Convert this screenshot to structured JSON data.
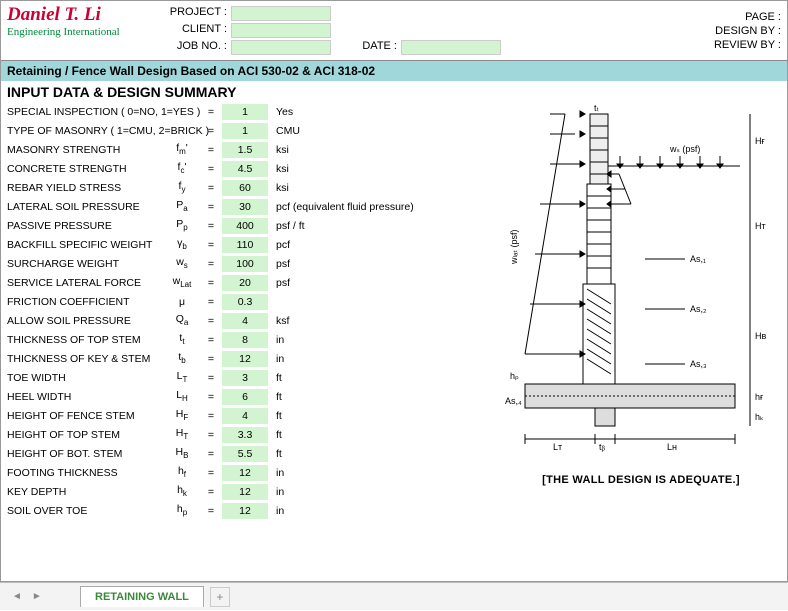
{
  "header": {
    "logo_name": "Daniel T. Li",
    "logo_sub": "Engineering International",
    "project_lbl": "PROJECT :",
    "client_lbl": "CLIENT :",
    "jobno_lbl": "JOB NO. :",
    "date_lbl": "DATE :",
    "page_lbl": "PAGE :",
    "designby_lbl": "DESIGN BY :",
    "reviewby_lbl": "REVIEW BY :"
  },
  "titlebar": "Retaining / Fence Wall Design Based on ACI 530-02 & ACI 318-02",
  "section_title": "INPUT DATA & DESIGN SUMMARY",
  "rows": [
    {
      "desc": "SPECIAL INSPECTION ( 0=NO, 1=YES )",
      "sym": "",
      "val": "1",
      "unit": "Yes"
    },
    {
      "desc": "TYPE OF MASONRY ( 1=CMU, 2=BRICK )",
      "sym": "",
      "val": "1",
      "unit": "CMU"
    },
    {
      "desc": "MASONRY STRENGTH",
      "sym": "f<sub>m</sub>'",
      "val": "1.5",
      "unit": "ksi"
    },
    {
      "desc": "CONCRETE STRENGTH",
      "sym": "f<sub>c</sub>'",
      "val": "4.5",
      "unit": "ksi"
    },
    {
      "desc": "REBAR YIELD STRESS",
      "sym": "f<sub>y</sub>",
      "val": "60",
      "unit": "ksi"
    },
    {
      "desc": "LATERAL SOIL PRESSURE",
      "sym": "P<sub>a</sub>",
      "val": "30",
      "unit": "pcf (equivalent fluid pressure)"
    },
    {
      "desc": "PASSIVE PRESSURE",
      "sym": "P<sub>p</sub>",
      "val": "400",
      "unit": "psf / ft"
    },
    {
      "desc": "BACKFILL SPECIFIC WEIGHT",
      "sym": "γ<sub>b</sub>",
      "val": "110",
      "unit": "pcf"
    },
    {
      "desc": "SURCHARGE WEIGHT",
      "sym": "w<sub>s</sub>",
      "val": "100",
      "unit": "psf"
    },
    {
      "desc": "SERVICE LATERAL FORCE",
      "sym": "w<sub>Lat</sub>",
      "val": "20",
      "unit": "psf"
    },
    {
      "desc": "FRICTION COEFFICIENT",
      "sym": "μ",
      "val": "0.3",
      "unit": ""
    },
    {
      "desc": "ALLOW SOIL PRESSURE",
      "sym": "Q<sub>a</sub>",
      "val": "4",
      "unit": "ksf"
    },
    {
      "desc": "THICKNESS OF TOP STEM",
      "sym": "t<sub>t</sub>",
      "val": "8",
      "unit": "in"
    },
    {
      "desc": "THICKNESS OF KEY & STEM",
      "sym": "t<sub>b</sub>",
      "val": "12",
      "unit": "in"
    },
    {
      "desc": "TOE WIDTH",
      "sym": "L<sub>T</sub>",
      "val": "3",
      "unit": "ft"
    },
    {
      "desc": "HEEL WIDTH",
      "sym": "L<sub>H</sub>",
      "val": "6",
      "unit": "ft"
    },
    {
      "desc": "HEIGHT OF FENCE STEM",
      "sym": "H<sub>F</sub>",
      "val": "4",
      "unit": "ft"
    },
    {
      "desc": "HEIGHT OF TOP STEM",
      "sym": "H<sub>T</sub>",
      "val": "3.3",
      "unit": "ft"
    },
    {
      "desc": "HEIGHT OF BOT. STEM",
      "sym": "H<sub>B</sub>",
      "val": "5.5",
      "unit": "ft"
    },
    {
      "desc": "FOOTING THICKNESS",
      "sym": "h<sub>f</sub>",
      "val": "12",
      "unit": "in"
    },
    {
      "desc": "KEY DEPTH",
      "sym": "h<sub>k</sub>",
      "val": "12",
      "unit": "in"
    },
    {
      "desc": "SOIL OVER TOE",
      "sym": "h<sub>p</sub>",
      "val": "12",
      "unit": "in"
    }
  ],
  "diagram_labels": {
    "tt": "tₜ",
    "ws": "wₛ (psf)",
    "HF": "Hғ",
    "wlat": "wₗₐₜ (psf)",
    "HT": "Hᴛ",
    "As1": "As,₁",
    "As2": "As,₂",
    "HB": "Hʙ",
    "As3": "As,₃",
    "hp": "hₚ",
    "As4": "As,₄",
    "hf": "hғ",
    "hk": "hₖ",
    "LT": "Lᴛ",
    "tb": "tᵦ",
    "LH": "Lн"
  },
  "adequate": "[THE WALL DESIGN IS ADEQUATE.]",
  "tab": "RETAINING WALL"
}
